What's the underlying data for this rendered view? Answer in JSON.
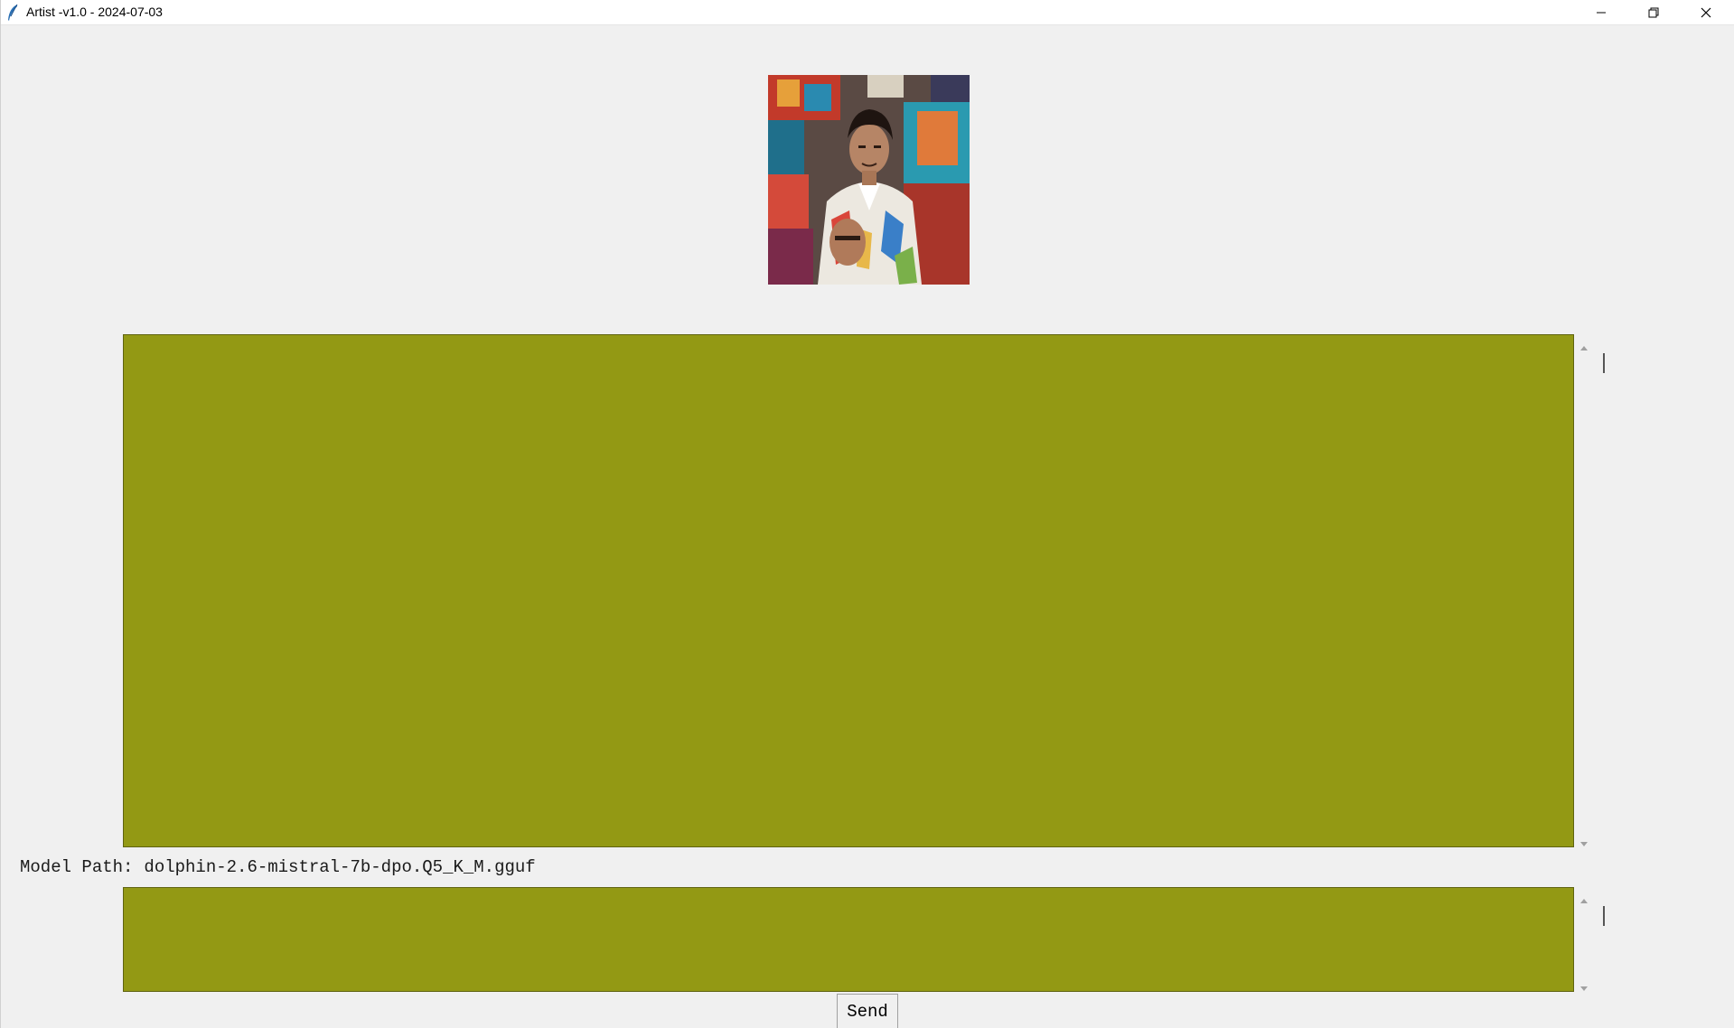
{
  "window": {
    "title": "Artist -v1.0 - 2024-07-03",
    "app_icon": "feather-icon",
    "controls": {
      "minimize_icon": "minimize-icon",
      "maximize_icon": "restore-icon",
      "close_icon": "close-icon"
    }
  },
  "avatar": {
    "icon": "portrait-image"
  },
  "output_area": {
    "text": "",
    "background": "#939914"
  },
  "model_path": {
    "label": "Model Path:",
    "value": "dolphin-2.6-mistral-7b-dpo.Q5_K_M.gguf"
  },
  "input_area": {
    "text": "",
    "background": "#939914"
  },
  "send_button": {
    "label": "Send"
  }
}
